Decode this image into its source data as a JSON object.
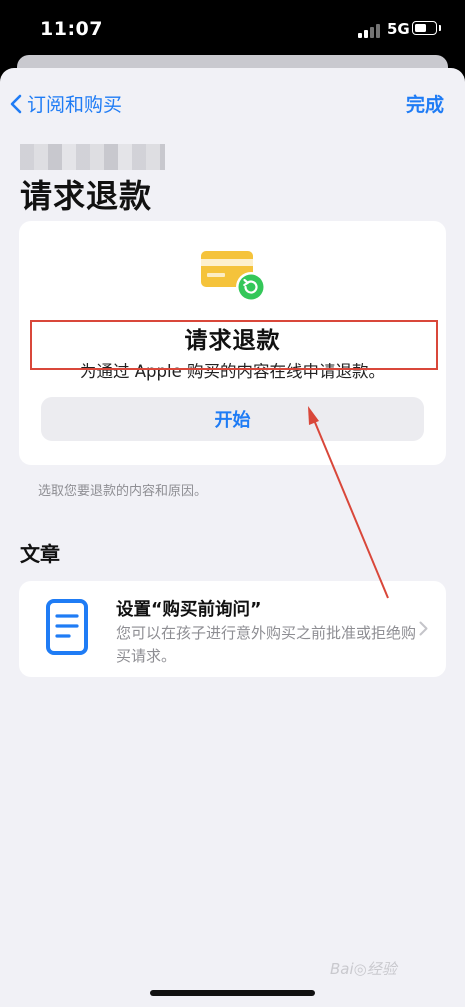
{
  "status_bar": {
    "time": "11:07",
    "network": "5G"
  },
  "nav": {
    "back_label": "订阅和购买",
    "done_label": "完成"
  },
  "page_title": "请求退款",
  "refund_card": {
    "title": "请求退款",
    "description": "为通过 Apple 购买的内容在线申请退款。",
    "start_button": "开始"
  },
  "footer_note": "选取您要退款的内容和原因。",
  "articles": {
    "header": "文章",
    "items": [
      {
        "title": "设置“购买前询问”",
        "description": "您可以在孩子进行意外购买之前批准或拒绝购买请求。"
      }
    ]
  },
  "watermark": "Bai◎经验",
  "colors": {
    "accent": "#1f7cf5",
    "annotation": "#d9473a",
    "card_icon": "#f5c33b",
    "badge": "#34c759"
  },
  "icons": {
    "back": "chevron-left-icon",
    "refund": "credit-card-refund-icon",
    "article": "document-icon",
    "disclosure": "chevron-right-icon"
  }
}
